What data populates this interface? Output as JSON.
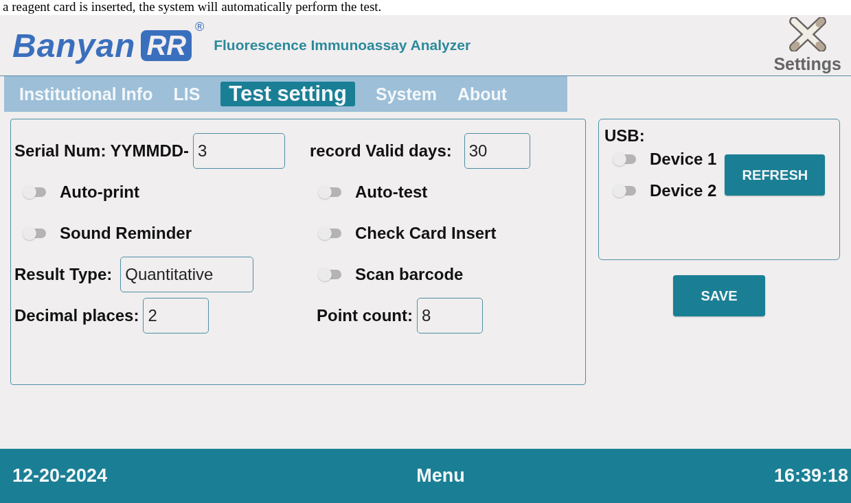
{
  "caption": "a reagent card is inserted, the system will automatically perform the test.",
  "header": {
    "logo": "Banyan",
    "logo_badge": "RR",
    "registered": "®",
    "subtitle": "Fluorescence Immunoassay Analyzer",
    "settings_label": "Settings"
  },
  "tabs": [
    {
      "label": "Institutional Info",
      "selected": false
    },
    {
      "label": "LIS",
      "selected": false
    },
    {
      "label": "Test setting",
      "selected": true
    },
    {
      "label": "System",
      "selected": false
    },
    {
      "label": "About",
      "selected": false
    }
  ],
  "serial": {
    "label": "Serial Num:",
    "prefix": "YYMMDD-",
    "value": "3"
  },
  "valid_days": {
    "label": "record Valid days:",
    "value": "30"
  },
  "left_toggles": [
    {
      "label": "Auto-print",
      "on": false
    },
    {
      "label": "Sound Reminder",
      "on": false
    }
  ],
  "right_toggles": [
    {
      "label": "Auto-test",
      "on": false
    },
    {
      "label": "Check Card Insert",
      "on": false
    },
    {
      "label": "Scan barcode",
      "on": false
    }
  ],
  "result_type": {
    "label": "Result Type:",
    "value": "Quantitative"
  },
  "decimal_places": {
    "label": "Decimal places:",
    "value": "2"
  },
  "point_count": {
    "label": "Point count:",
    "value": "8"
  },
  "usb": {
    "title": "USB:",
    "devices": [
      {
        "label": "Device 1",
        "on": false
      },
      {
        "label": "Device 2",
        "on": false
      }
    ],
    "refresh": "REFRESH"
  },
  "save": "SAVE",
  "status_bar": {
    "date": "12-20-2024",
    "menu": "Menu",
    "time": "16:39:18"
  }
}
